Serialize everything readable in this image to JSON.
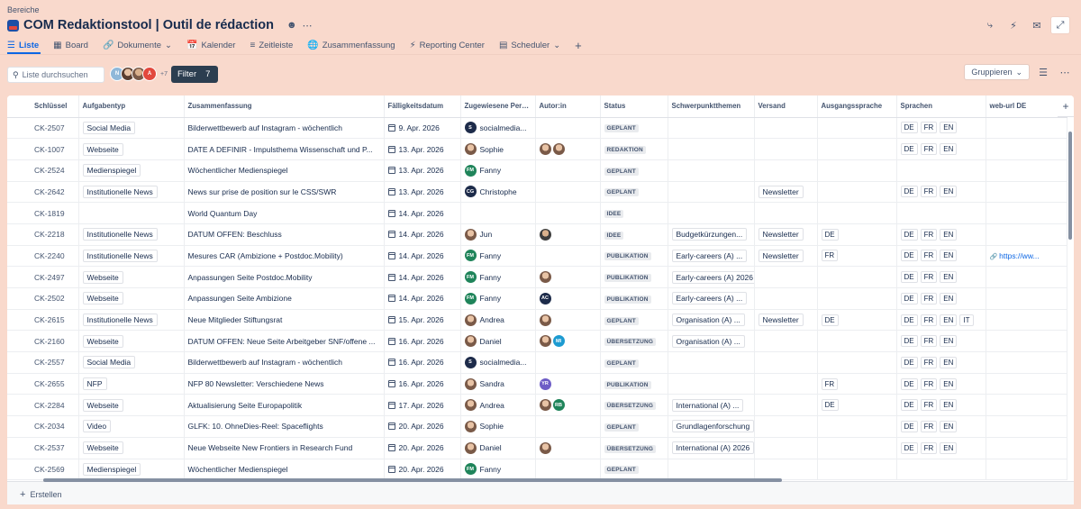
{
  "header": {
    "breadcrumb": "Bereiche",
    "title": "COM Redaktionstool | Outil de rédaction",
    "people_icon": "people-icon",
    "more_icon": "more-icon",
    "actions": [
      "share-icon",
      "lightning-icon",
      "feedback-icon",
      "fullscreen-icon"
    ]
  },
  "tabs": [
    {
      "label": "Liste",
      "icon": "list-icon"
    },
    {
      "label": "Board",
      "icon": "board-icon"
    },
    {
      "label": "Dokumente",
      "icon": "link-icon"
    },
    {
      "label": "Kalender",
      "icon": "calendar-icon"
    },
    {
      "label": "Zeitleiste",
      "icon": "timeline-icon"
    },
    {
      "label": "Zusammenfassung",
      "icon": "globe-icon"
    },
    {
      "label": "Reporting Center",
      "icon": "bolt-icon"
    },
    {
      "label": "Scheduler",
      "icon": "scheduler-icon"
    }
  ],
  "toolbar": {
    "search_placeholder": "Liste durchsuchen",
    "avatars_more": "+7",
    "filter_label": "Filter",
    "filter_count": "7",
    "group_label": "Gruppieren"
  },
  "columns": [
    "Schlüssel",
    "Aufgabentyp",
    "Zusammenfassung",
    "Fälligkeitsdatum",
    "Zugewiesene Person",
    "Autor:in",
    "Status",
    "Schwerpunktthemen",
    "Versand",
    "Ausgangssprache",
    "Sprachen",
    "web-url DE"
  ],
  "rows": [
    {
      "key": "CK-2507",
      "type": "Social Media",
      "summary": "Bilderwettbewerb auf Instagram - wöchentlich",
      "date": "9. Apr. 2026",
      "assignee": "socialmedia...",
      "av": "S",
      "avc": "#1d2b4a",
      "authors": [],
      "status": "GEPLANT",
      "topic": "",
      "versand": "",
      "source": "",
      "langs": [
        "DE",
        "FR",
        "EN"
      ],
      "url": ""
    },
    {
      "key": "CK-1007",
      "type": "Webseite",
      "summary": "DATE A DEFINIR - Impulsthema Wissenschaft und P...",
      "date": "13. Apr. 2026",
      "assignee": "Sophie",
      "av": "",
      "avc": "photo",
      "authors": [
        "photo",
        "photo"
      ],
      "status": "REDAKTION",
      "topic": "",
      "versand": "",
      "source": "",
      "langs": [
        "DE",
        "FR",
        "EN"
      ],
      "url": ""
    },
    {
      "key": "CK-2524",
      "type": "Medienspiegel",
      "summary": "Wöchentlicher Medienspiegel",
      "date": "13. Apr. 2026",
      "assignee": "Fanny",
      "av": "FM",
      "avc": "#1f845a",
      "authors": [],
      "status": "GEPLANT",
      "topic": "",
      "versand": "",
      "source": "",
      "langs": [],
      "url": ""
    },
    {
      "key": "CK-2642",
      "type": "Institutionelle News",
      "summary": "News sur prise de position sur le CSS/SWR",
      "date": "13. Apr. 2026",
      "assignee": "Christophe",
      "av": "CG",
      "avc": "#1d2b4a",
      "authors": [],
      "status": "GEPLANT",
      "topic": "",
      "versand": "Newsletter",
      "source": "",
      "langs": [
        "DE",
        "FR",
        "EN"
      ],
      "url": ""
    },
    {
      "key": "CK-1819",
      "type": "",
      "summary": "World Quantum Day",
      "date": "14. Apr. 2026",
      "assignee": "",
      "av": "",
      "avc": "",
      "authors": [],
      "status": "IDEE",
      "topic": "",
      "versand": "",
      "source": "",
      "langs": [],
      "url": ""
    },
    {
      "key": "CK-2218",
      "type": "Institutionelle News",
      "summary": "DATUM OFFEN: Beschluss",
      "date": "14. Apr. 2026",
      "assignee": "Jun",
      "av": "",
      "avc": "photo",
      "authors": [
        "photo2"
      ],
      "status": "IDEE",
      "topic": "Budgetkürzungen...",
      "versand": "Newsletter",
      "source": "DE",
      "langs": [
        "DE",
        "FR",
        "EN"
      ],
      "url": ""
    },
    {
      "key": "CK-2240",
      "type": "Institutionelle News",
      "summary": "Mesures CAR (Ambizione + Postdoc.Mobility)",
      "date": "14. Apr. 2026",
      "assignee": "Fanny",
      "av": "FM",
      "avc": "#1f845a",
      "authors": [],
      "status": "PUBLIKATION",
      "topic": "Early-careers (A) ...",
      "versand": "Newsletter",
      "source": "FR",
      "langs": [
        "DE",
        "FR",
        "EN"
      ],
      "url": "https://ww..."
    },
    {
      "key": "CK-2497",
      "type": "Webseite",
      "summary": "Anpassungen Seite Postdoc.Mobility",
      "date": "14. Apr. 2026",
      "assignee": "Fanny",
      "av": "FM",
      "avc": "#1f845a",
      "authors": [
        "photo"
      ],
      "status": "PUBLIKATION",
      "topic": "Early-careers (A) 2026",
      "versand": "",
      "source": "",
      "langs": [
        "DE",
        "FR",
        "EN"
      ],
      "url": ""
    },
    {
      "key": "CK-2502",
      "type": "Webseite",
      "summary": "Anpassungen Seite Ambizione",
      "date": "14. Apr. 2026",
      "assignee": "Fanny",
      "av": "FM",
      "avc": "#1f845a",
      "authors": [
        "AC"
      ],
      "status": "PUBLIKATION",
      "topic": "Early-careers (A) ...",
      "versand": "",
      "source": "",
      "langs": [
        "DE",
        "FR",
        "EN"
      ],
      "url": ""
    },
    {
      "key": "CK-2615",
      "type": "Institutionelle News",
      "summary": "Neue Mitglieder Stiftungsrat",
      "date": "15. Apr. 2026",
      "assignee": "Andrea",
      "av": "",
      "avc": "photo",
      "authors": [
        "photo"
      ],
      "status": "GEPLANT",
      "topic": "Organisation (A) ...",
      "versand": "Newsletter",
      "source": "DE",
      "langs": [
        "DE",
        "FR",
        "EN",
        "IT"
      ],
      "url": ""
    },
    {
      "key": "CK-2160",
      "type": "Webseite",
      "summary": "DATUM OFFEN: Neue Seite Arbeitgeber SNF/offene ...",
      "date": "16. Apr. 2026",
      "assignee": "Daniel",
      "av": "",
      "avc": "photo",
      "authors": [
        "photo",
        "MI"
      ],
      "status": "ÜBERSETZUNG",
      "topic": "Organisation (A) ...",
      "versand": "",
      "source": "",
      "langs": [
        "DE",
        "FR",
        "EN"
      ],
      "url": ""
    },
    {
      "key": "CK-2557",
      "type": "Social Media",
      "summary": "Bilderwettbewerb auf Instagram - wöchentlich",
      "date": "16. Apr. 2026",
      "assignee": "socialmedia...",
      "av": "S",
      "avc": "#1d2b4a",
      "authors": [],
      "status": "GEPLANT",
      "topic": "",
      "versand": "",
      "source": "",
      "langs": [
        "DE",
        "FR",
        "EN"
      ],
      "url": ""
    },
    {
      "key": "CK-2655",
      "type": "NFP",
      "summary": "NFP 80 Newsletter: Verschiedene News",
      "date": "16. Apr. 2026",
      "assignee": "Sandra",
      "av": "",
      "avc": "photo",
      "authors": [
        "YR"
      ],
      "status": "PUBLIKATION",
      "topic": "",
      "versand": "",
      "source": "FR",
      "langs": [
        "DE",
        "FR",
        "EN"
      ],
      "url": ""
    },
    {
      "key": "CK-2284",
      "type": "Webseite",
      "summary": "Aktualisierung Seite Europapolitik",
      "date": "17. Apr. 2026",
      "assignee": "Andrea",
      "av": "",
      "avc": "photo",
      "authors": [
        "photo",
        "RB"
      ],
      "status": "ÜBERSETZUNG",
      "topic": "International (A) ...",
      "versand": "",
      "source": "DE",
      "langs": [
        "DE",
        "FR",
        "EN"
      ],
      "url": ""
    },
    {
      "key": "CK-2034",
      "type": "Video",
      "summary": "GLFK: 10. OhneDies-Reel: Spaceflights",
      "date": "20. Apr. 2026",
      "assignee": "Sophie",
      "av": "",
      "avc": "photo",
      "authors": [],
      "status": "GEPLANT",
      "topic": "Grundlagenforschung",
      "versand": "",
      "source": "",
      "langs": [
        "DE",
        "FR",
        "EN"
      ],
      "url": ""
    },
    {
      "key": "CK-2537",
      "type": "Webseite",
      "summary": "Neue Webseite New Frontiers in Research Fund",
      "date": "20. Apr. 2026",
      "assignee": "Daniel",
      "av": "",
      "avc": "photo",
      "authors": [
        "photo"
      ],
      "status": "ÜBERSETZUNG",
      "topic": "International (A) 2026",
      "versand": "",
      "source": "",
      "langs": [
        "DE",
        "FR",
        "EN"
      ],
      "url": ""
    },
    {
      "key": "CK-2569",
      "type": "Medienspiegel",
      "summary": "Wöchentlicher Medienspiegel",
      "date": "20. Apr. 2026",
      "assignee": "Fanny",
      "av": "FM",
      "avc": "#1f845a",
      "authors": [],
      "status": "GEPLANT",
      "topic": "",
      "versand": "",
      "source": "",
      "langs": [],
      "url": ""
    }
  ],
  "author_colors": {
    "AC": "#1d2b4a",
    "MI": "#1d9bd1",
    "YR": "#6e5dc6",
    "RB": "#1f845a"
  },
  "footer": {
    "create_label": "Erstellen"
  }
}
